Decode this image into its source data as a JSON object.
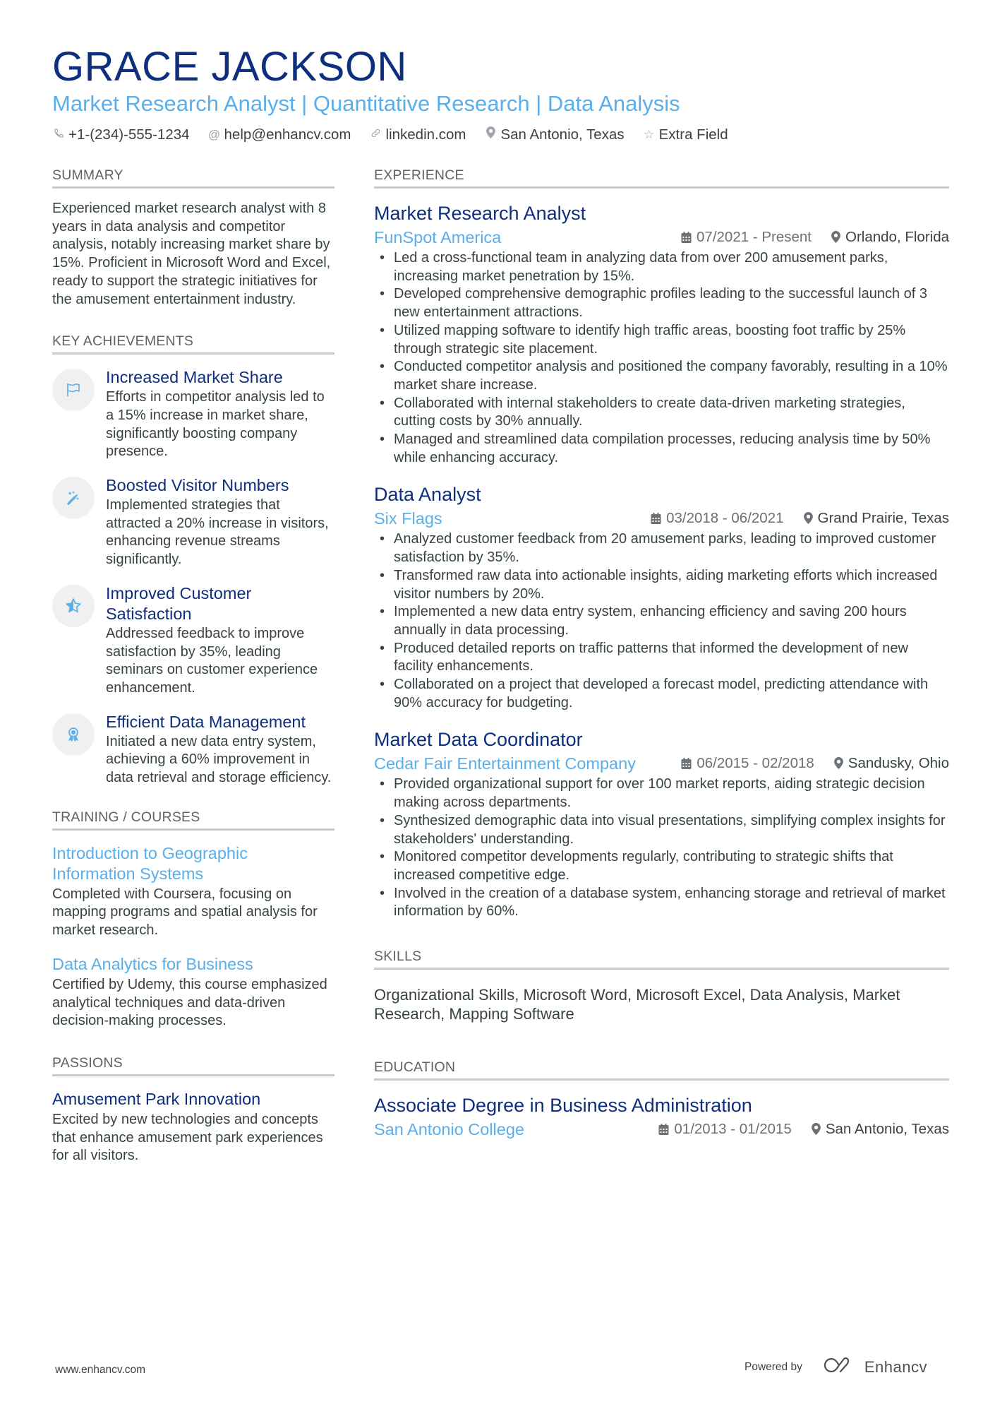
{
  "header": {
    "name": "GRACE JACKSON",
    "headline": "Market Research Analyst | Quantitative Research | Data Analysis",
    "contacts": [
      {
        "icon": "phone-icon",
        "text": "+1-(234)-555-1234"
      },
      {
        "icon": "at-icon",
        "text": "help@enhancv.com"
      },
      {
        "icon": "link-icon",
        "text": "linkedin.com"
      },
      {
        "icon": "location-icon",
        "text": "San Antonio, Texas"
      },
      {
        "icon": "star-icon",
        "text": "Extra Field"
      }
    ]
  },
  "summary": {
    "title": "SUMMARY",
    "text": "Experienced market research analyst with 8 years in data analysis and competitor analysis, notably increasing market share by 15%. Proficient in Microsoft Word and Excel, ready to support the strategic initiatives for the amusement entertainment industry."
  },
  "achievements": {
    "title": "KEY ACHIEVEMENTS",
    "items": [
      {
        "icon": "flag-icon",
        "title": "Increased Market Share",
        "text": "Efforts in competitor analysis led to a 15% increase in market share, significantly boosting company presence."
      },
      {
        "icon": "magic-wand-icon",
        "title": "Boosted Visitor Numbers",
        "text": "Implemented strategies that attracted a 20% increase in visitors, enhancing revenue streams significantly."
      },
      {
        "icon": "half-star-icon",
        "title": "Improved Customer Satisfaction",
        "text": "Addressed feedback to improve satisfaction by 35%, leading seminars on customer experience enhancement."
      },
      {
        "icon": "award-ribbon-icon",
        "title": "Efficient Data Management",
        "text": "Initiated a new data entry system, achieving a 60% improvement in data retrieval and storage efficiency."
      }
    ]
  },
  "training": {
    "title": "TRAINING / COURSES",
    "items": [
      {
        "title": "Introduction to Geographic Information Systems",
        "text": "Completed with Coursera, focusing on mapping programs and spatial analysis for market research."
      },
      {
        "title": "Data Analytics for Business",
        "text": "Certified by Udemy, this course emphasized analytical techniques and data-driven decision-making processes."
      }
    ]
  },
  "passions": {
    "title": "PASSIONS",
    "items": [
      {
        "title": "Amusement Park Innovation",
        "text": "Excited by new technologies and concepts that enhance amusement park experiences for all visitors."
      }
    ]
  },
  "experience": {
    "title": "EXPERIENCE",
    "jobs": [
      {
        "title": "Market Research Analyst",
        "company": "FunSpot America",
        "dates": "07/2021 - Present",
        "location": "Orlando, Florida",
        "bullets": [
          "Led a cross-functional team in analyzing data from over 200 amusement parks, increasing market penetration by 15%.",
          "Developed comprehensive demographic profiles leading to the successful launch of 3 new entertainment attractions.",
          "Utilized mapping software to identify high traffic areas, boosting foot traffic by 25% through strategic site placement.",
          "Conducted competitor analysis and positioned the company favorably, resulting in a 10% market share increase.",
          "Collaborated with internal stakeholders to create data-driven marketing strategies, cutting costs by 30% annually.",
          "Managed and streamlined data compilation processes, reducing analysis time by 50% while enhancing accuracy."
        ]
      },
      {
        "title": "Data Analyst",
        "company": "Six Flags",
        "dates": "03/2018 - 06/2021",
        "location": "Grand Prairie, Texas",
        "bullets": [
          "Analyzed customer feedback from 20 amusement parks, leading to improved customer satisfaction by 35%.",
          "Transformed raw data into actionable insights, aiding marketing efforts which increased visitor numbers by 20%.",
          "Implemented a new data entry system, enhancing efficiency and saving 200 hours annually in data processing.",
          "Produced detailed reports on traffic patterns that informed the development of new facility enhancements.",
          "Collaborated on a project that developed a forecast model, predicting attendance with 90% accuracy for budgeting."
        ]
      },
      {
        "title": "Market Data Coordinator",
        "company": "Cedar Fair Entertainment Company",
        "dates": "06/2015 - 02/2018",
        "location": "Sandusky, Ohio",
        "bullets": [
          "Provided organizational support for over 100 market reports, aiding strategic decision making across departments.",
          "Synthesized demographic data into visual presentations, simplifying complex insights for stakeholders' understanding.",
          "Monitored competitor developments regularly, contributing to strategic shifts that increased competitive edge.",
          "Involved in the creation of a database system, enhancing storage and retrieval of market information by 60%."
        ]
      }
    ]
  },
  "skills": {
    "title": "SKILLS",
    "text": "Organizational Skills, Microsoft Word, Microsoft Excel, Data Analysis, Market Research, Mapping Software"
  },
  "education": {
    "title": "EDUCATION",
    "items": [
      {
        "degree": "Associate Degree in Business Administration",
        "school": "San Antonio College",
        "dates": "01/2013 - 01/2015",
        "location": "San Antonio, Texas"
      }
    ]
  },
  "footer": {
    "website": "www.enhancv.com",
    "powered_by": "Powered by",
    "brand": "Enhancv"
  },
  "colors": {
    "name": "#0d2f7d",
    "accent": "#5aaeea",
    "text": "#384347",
    "section_title": "#5d6368",
    "rule": "#c8cacc",
    "icon_circle": "#f0f0f0"
  }
}
